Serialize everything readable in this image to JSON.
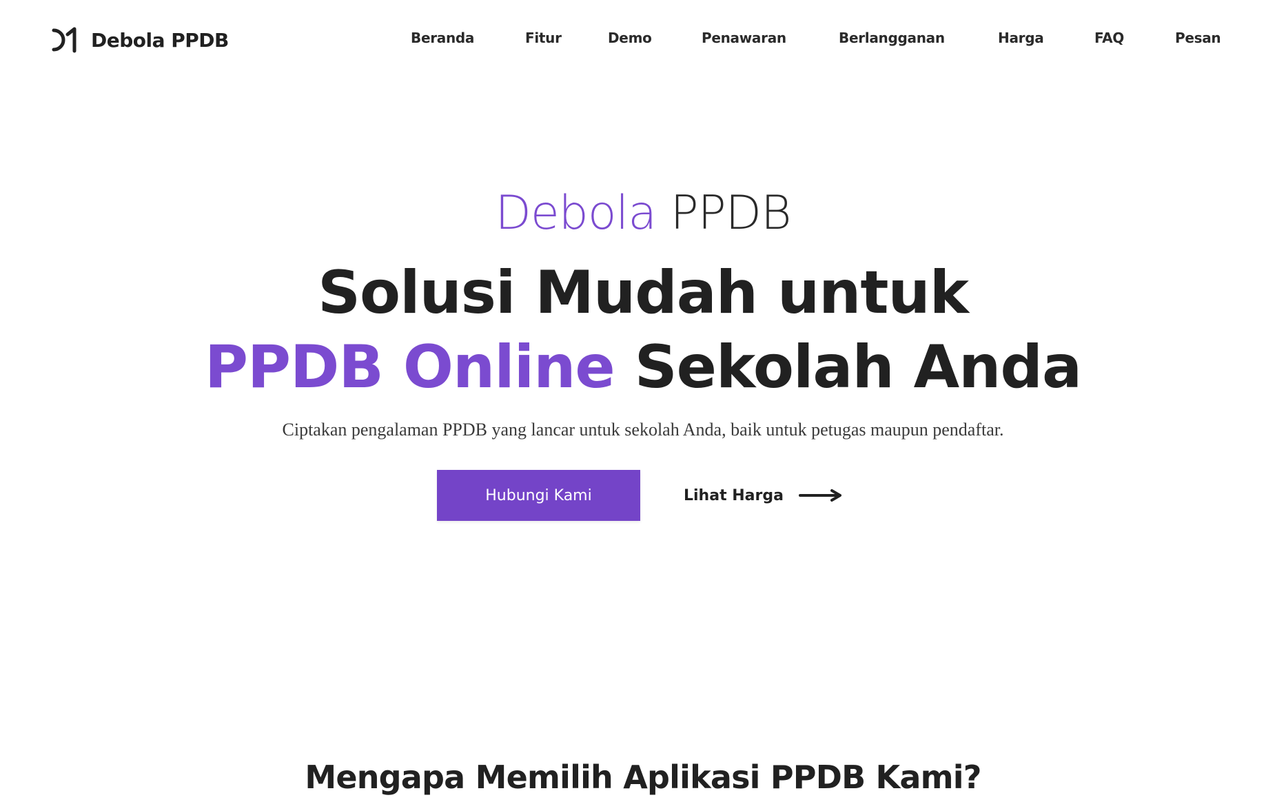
{
  "header": {
    "brand": {
      "logo_icon": "d1-logo-mark",
      "name": "Debola PPDB"
    },
    "nav": [
      {
        "label": "Beranda"
      },
      {
        "label": "Fitur"
      },
      {
        "label": "Demo"
      },
      {
        "label": "Penawaran"
      },
      {
        "label": "Berlangganan"
      },
      {
        "label": "Harga"
      },
      {
        "label": "FAQ"
      },
      {
        "label": "Pesan"
      }
    ]
  },
  "hero": {
    "eyebrow_accent": "Debola",
    "eyebrow_plain": "PPDB",
    "title_line1": "Solusi Mudah untuk",
    "title_line2_accent": "PPDB Online",
    "title_line2_plain": "Sekolah Anda",
    "subtitle": "Ciptakan pengalaman PPDB yang lancar untuk sekolah Anda, baik untuk petugas maupun pendaftar.",
    "primary_button": "Hubungi Kami",
    "secondary_link": "Lihat Harga",
    "secondary_icon": "arrow-right-icon"
  },
  "section": {
    "title": "Mengapa Memilih Aplikasi PPDB Kami?"
  },
  "colors": {
    "accent": "#7b4bd0",
    "button": "#7444c8",
    "text": "#212121"
  }
}
